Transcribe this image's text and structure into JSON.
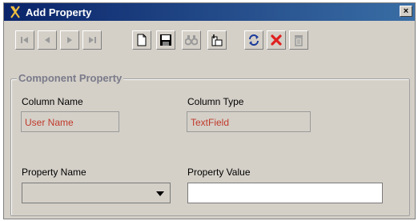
{
  "window": {
    "title": "Add Property",
    "close_label": "×"
  },
  "toolbar": {
    "buttons": [
      {
        "icon": "first-record-icon",
        "enabled": false
      },
      {
        "icon": "previous-record-icon",
        "enabled": false
      },
      {
        "icon": "next-record-icon",
        "enabled": false
      },
      {
        "icon": "last-record-icon",
        "enabled": false
      },
      {
        "icon": "new-document-icon",
        "enabled": true
      },
      {
        "icon": "save-icon",
        "enabled": true
      },
      {
        "icon": "find-icon",
        "enabled": false
      },
      {
        "icon": "edit-icon",
        "enabled": true
      },
      {
        "icon": "refresh-icon",
        "enabled": true
      },
      {
        "icon": "delete-icon",
        "enabled": true
      },
      {
        "icon": "trash-icon",
        "enabled": false
      }
    ]
  },
  "component_property": {
    "legend": "Component Property",
    "column_name_label": "Column Name",
    "column_name_value": "User Name",
    "column_type_label": "Column Type",
    "column_type_value": "TextField",
    "property_name_label": "Property Name",
    "property_name_value": "",
    "property_value_label": "Property Value",
    "property_value_value": ""
  },
  "colors": {
    "title_bar": "#0a246a",
    "dialog_bg": "#d4d0c8",
    "readonly_text": "#c0392b",
    "delete_red": "#e02020",
    "disabled_icon": "#9a9a9a"
  }
}
